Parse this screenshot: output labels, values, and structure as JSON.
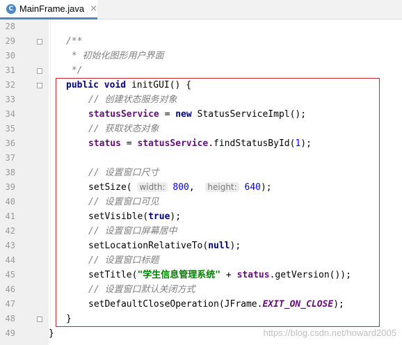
{
  "tab": {
    "icon_letter": "C",
    "filename": "MainFrame.java",
    "close_glyph": "×"
  },
  "lines": [
    {
      "n": "28",
      "fold": false,
      "indent": 0,
      "tokens": []
    },
    {
      "n": "29",
      "fold": true,
      "indent": 1,
      "tokens": [
        {
          "c": "cm",
          "t": "/**"
        }
      ]
    },
    {
      "n": "30",
      "fold": false,
      "indent": 1,
      "tokens": [
        {
          "c": "cm",
          "t": " * 初始化图形用户界面"
        }
      ]
    },
    {
      "n": "31",
      "fold": true,
      "indent": 1,
      "tokens": [
        {
          "c": "cm",
          "t": " */"
        }
      ]
    },
    {
      "n": "32",
      "fold": true,
      "indent": 1,
      "tokens": [
        {
          "c": "kw",
          "t": "public "
        },
        {
          "c": "kw",
          "t": "void "
        },
        {
          "c": "",
          "t": "initGUI() {"
        }
      ]
    },
    {
      "n": "33",
      "fold": false,
      "indent": 2,
      "tokens": [
        {
          "c": "cm",
          "t": "// 创建状态服务对象"
        }
      ]
    },
    {
      "n": "34",
      "fold": false,
      "indent": 2,
      "tokens": [
        {
          "c": "fld",
          "t": "statusService"
        },
        {
          "c": "",
          "t": " = "
        },
        {
          "c": "kw",
          "t": "new "
        },
        {
          "c": "",
          "t": "StatusServiceImpl();"
        }
      ]
    },
    {
      "n": "35",
      "fold": false,
      "indent": 2,
      "tokens": [
        {
          "c": "cm",
          "t": "// 获取状态对象"
        }
      ]
    },
    {
      "n": "36",
      "fold": false,
      "indent": 2,
      "tokens": [
        {
          "c": "fld",
          "t": "status"
        },
        {
          "c": "",
          "t": " = "
        },
        {
          "c": "fld",
          "t": "statusService"
        },
        {
          "c": "",
          "t": ".findStatusById("
        },
        {
          "c": "num",
          "t": "1"
        },
        {
          "c": "",
          "t": ");"
        }
      ]
    },
    {
      "n": "37",
      "fold": false,
      "indent": 0,
      "tokens": []
    },
    {
      "n": "38",
      "fold": false,
      "indent": 2,
      "tokens": [
        {
          "c": "cm",
          "t": "// 设置窗口尺寸"
        }
      ]
    },
    {
      "n": "39",
      "fold": false,
      "indent": 2,
      "tokens": [
        {
          "c": "",
          "t": "setSize( "
        },
        {
          "c": "hint",
          "t": "width:"
        },
        {
          "c": "",
          "t": " "
        },
        {
          "c": "num",
          "t": "800"
        },
        {
          "c": "",
          "t": ",  "
        },
        {
          "c": "hint",
          "t": "height:"
        },
        {
          "c": "",
          "t": " "
        },
        {
          "c": "num",
          "t": "640"
        },
        {
          "c": "",
          "t": ");"
        }
      ]
    },
    {
      "n": "40",
      "fold": false,
      "indent": 2,
      "tokens": [
        {
          "c": "cm",
          "t": "// 设置窗口可见"
        }
      ]
    },
    {
      "n": "41",
      "fold": false,
      "indent": 2,
      "tokens": [
        {
          "c": "",
          "t": "setVisible("
        },
        {
          "c": "kw",
          "t": "true"
        },
        {
          "c": "",
          "t": ");"
        }
      ]
    },
    {
      "n": "42",
      "fold": false,
      "indent": 2,
      "tokens": [
        {
          "c": "cm",
          "t": "// 设置窗口屏幕居中"
        }
      ]
    },
    {
      "n": "43",
      "fold": false,
      "indent": 2,
      "tokens": [
        {
          "c": "",
          "t": "setLocationRelativeTo("
        },
        {
          "c": "kw",
          "t": "null"
        },
        {
          "c": "",
          "t": ");"
        }
      ]
    },
    {
      "n": "44",
      "fold": false,
      "indent": 2,
      "tokens": [
        {
          "c": "cm",
          "t": "// 设置窗口标题"
        }
      ]
    },
    {
      "n": "45",
      "fold": false,
      "indent": 2,
      "tokens": [
        {
          "c": "",
          "t": "setTitle("
        },
        {
          "c": "str",
          "t": "\"学生信息管理系统\""
        },
        {
          "c": "",
          "t": " + "
        },
        {
          "c": "fld",
          "t": "status"
        },
        {
          "c": "",
          "t": ".getVersion());"
        }
      ]
    },
    {
      "n": "46",
      "fold": false,
      "indent": 2,
      "tokens": [
        {
          "c": "cm",
          "t": "// 设置窗口默认关闭方式"
        }
      ]
    },
    {
      "n": "47",
      "fold": false,
      "indent": 2,
      "tokens": [
        {
          "c": "",
          "t": "setDefaultCloseOperation(JFrame."
        },
        {
          "c": "const",
          "t": "EXIT_ON_CLOSE"
        },
        {
          "c": "",
          "t": ");"
        }
      ]
    },
    {
      "n": "48",
      "fold": true,
      "indent": 1,
      "tokens": [
        {
          "c": "",
          "t": "}"
        }
      ]
    },
    {
      "n": "49",
      "fold": false,
      "indent": 0,
      "tokens": [
        {
          "c": "",
          "t": "}"
        }
      ]
    }
  ],
  "watermark": "https://blog.csdn.net/howard2005",
  "colors": {
    "highlight_border": "#c8262b",
    "tab_accent": "#4a88c7"
  }
}
